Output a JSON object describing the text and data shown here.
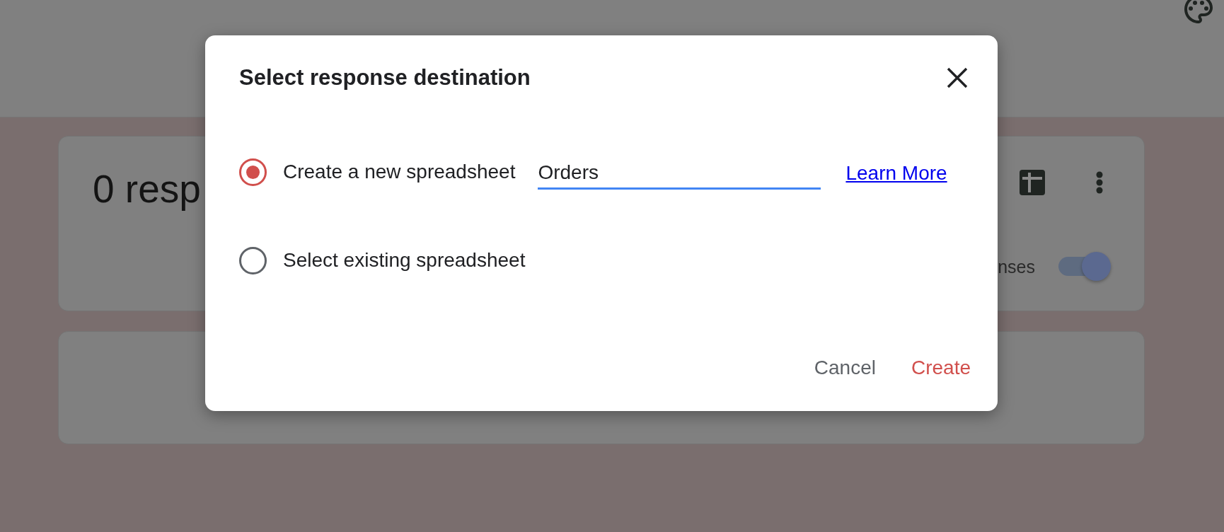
{
  "responses_card": {
    "title": "0 resp",
    "toggle_label": "nses",
    "toggle": {
      "on": true
    }
  },
  "dialog": {
    "title": "Select response destination",
    "options": [
      {
        "label": "Create a new spreadsheet",
        "selected": true,
        "field": {
          "value": "Orders",
          "focused": true
        },
        "link": "Learn More"
      },
      {
        "label": "Select existing spreadsheet",
        "selected": false
      }
    ],
    "buttons": [
      {
        "label": "Cancel",
        "kind": "cancel"
      },
      {
        "label": "Create",
        "kind": "confirm"
      }
    ]
  }
}
